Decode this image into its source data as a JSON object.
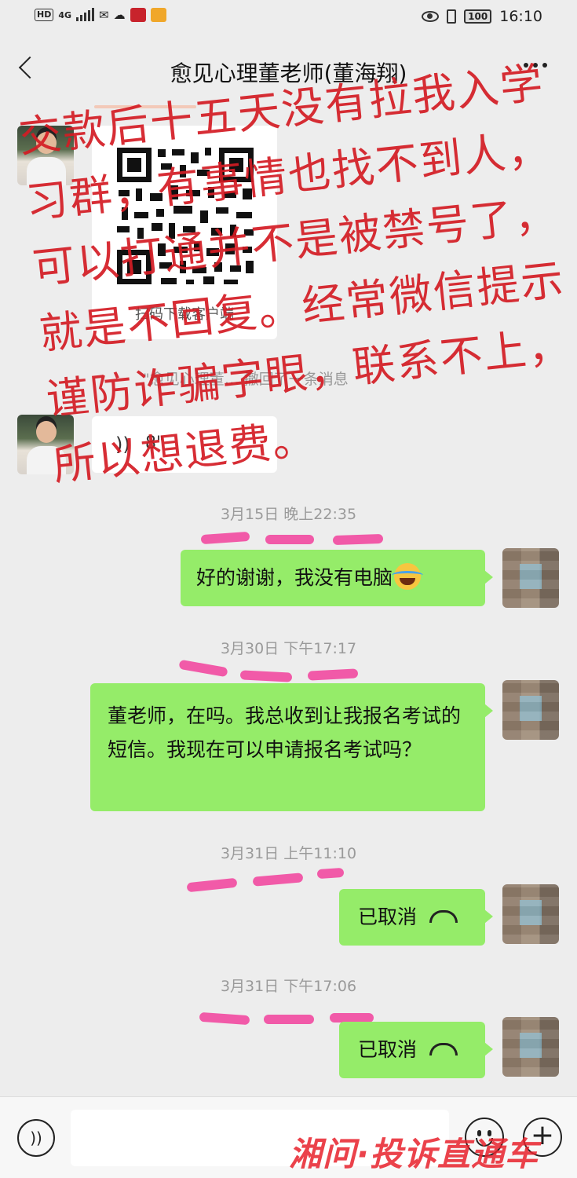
{
  "status_bar": {
    "hd": "HD",
    "network": "4G",
    "time": "16:10",
    "battery": "100"
  },
  "header": {
    "title": "愈见心理董老师(董海翔)"
  },
  "qr_card": {
    "caption": "扫码下载客户端"
  },
  "qr_subline": "\"愈见心理董… 撤回了一条消息",
  "voice_message": {
    "duration": "8\""
  },
  "messages": [
    {
      "timestamp": "3月15日 晚上22:35",
      "text": "好的谢谢，我没有电脑"
    },
    {
      "timestamp": "3月30日 下午17:17",
      "text": "董老师，在吗。我总收到让我报名考试的短信。我现在可以申请报名考试吗？"
    },
    {
      "timestamp": "3月31日 上午11:10",
      "text": "已取消"
    },
    {
      "timestamp": "3月31日 下午17:06",
      "text": "已取消"
    }
  ],
  "overlay_text": "交款后十五天没有拉我入学习群，有事情也找不到人，可以打通并不是被禁号了，就是不回复。经常微信提示谨防诈骗字眼，联系不上，所以想退费。",
  "watermark": "湘问·投诉直通车",
  "colors": {
    "bubble_green": "#95ec69",
    "background": "#ededed",
    "overlay_red": "#d41c24",
    "censor_pink": "#f15aa8"
  }
}
